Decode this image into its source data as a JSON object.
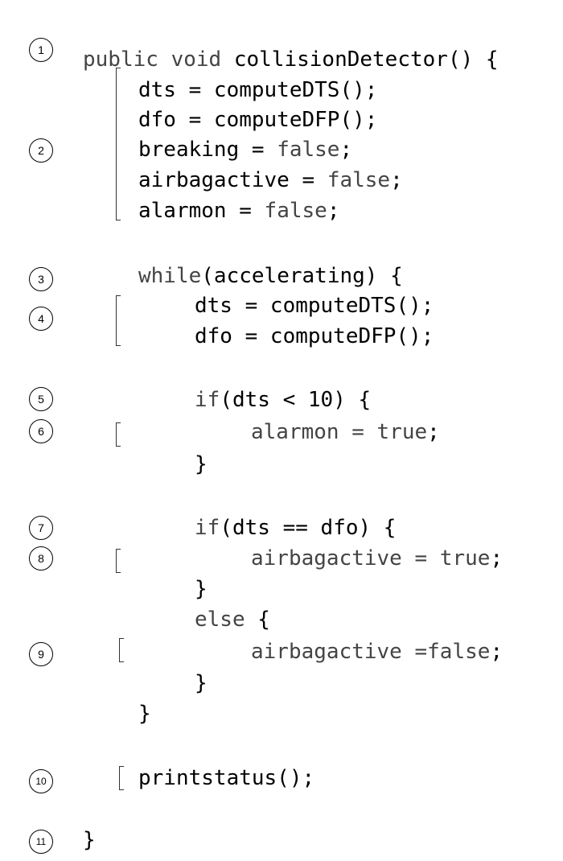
{
  "markers": [
    "1",
    "2",
    "3",
    "4",
    "5",
    "6",
    "7",
    "8",
    "9",
    "10",
    "11"
  ],
  "code": {
    "l1_kw": "public void ",
    "l1_id": "collisionDetector() {",
    "l2_id": "dts = computeDTS();",
    "l3_id": "dfo = computeDFP();",
    "l4_id": "breaking = ",
    "l4_val": "false",
    "l4_end": ";",
    "l5_id": "airbagactive = ",
    "l5_val": "false",
    "l5_end": ";",
    "l6_id": "alarmon = ",
    "l6_val": "false",
    "l6_end": ";",
    "l7_kw": "while",
    "l7_id": "(accelerating) {",
    "l8_id": "dts = computeDTS();",
    "l9_id": "dfo = computeDFP();",
    "l10_kw": "if",
    "l10_id": "(dts < 10) {",
    "l11_id": "alarmon = ",
    "l11_val": "true",
    "l11_end": ";",
    "l12_id": "}",
    "l13_kw": "if",
    "l13_id": "(dts == dfo) {",
    "l14_id": "airbagactive = ",
    "l14_val": "true",
    "l14_end": ";",
    "l15_id": "}",
    "l16_kw": "else",
    "l16_id": " {",
    "l17_id": "airbagactive =",
    "l17_val": "false",
    "l17_end": ";",
    "l18_id": "}",
    "l19_id": "}",
    "l20_id": "printstatus();",
    "l21_id": "}"
  }
}
